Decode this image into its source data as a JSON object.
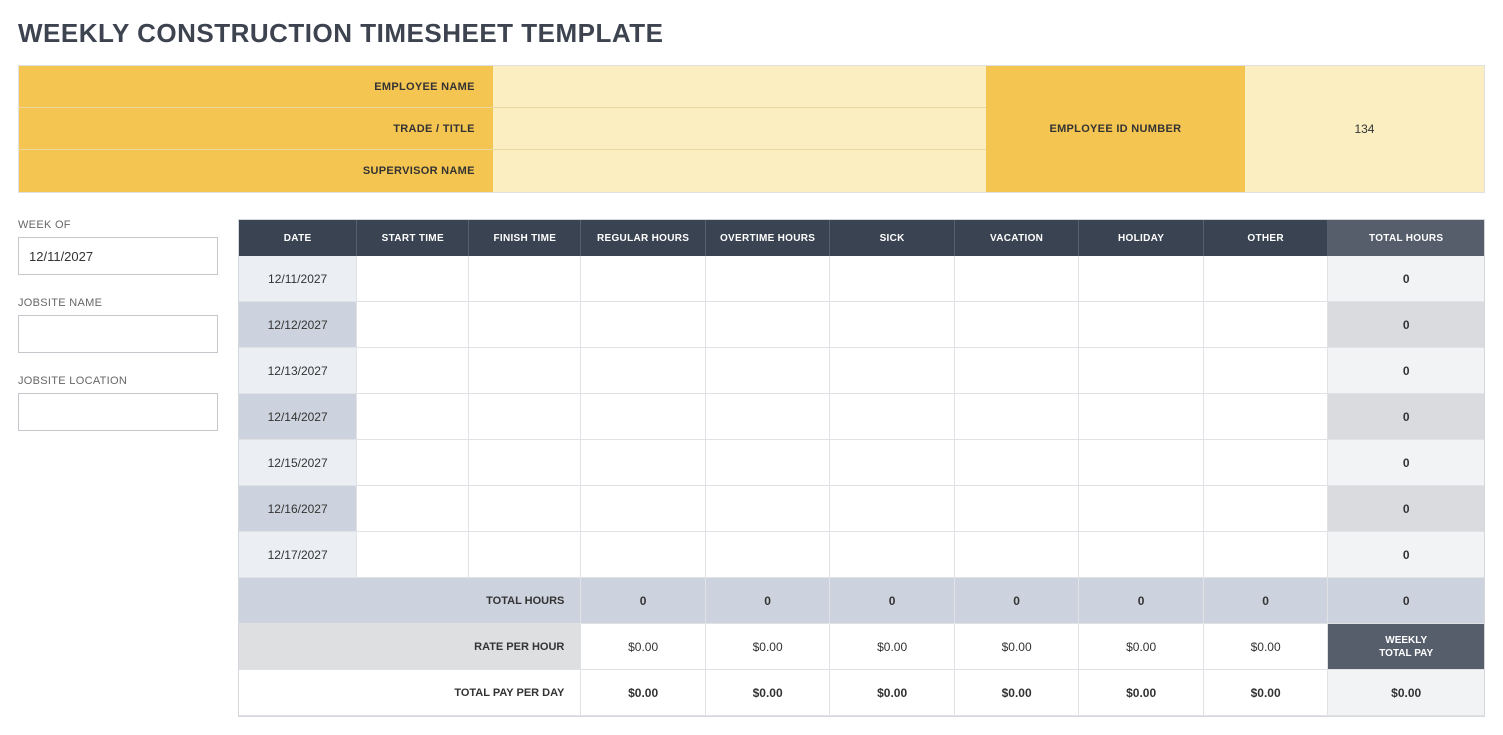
{
  "title": "WEEKLY CONSTRUCTION TIMESHEET TEMPLATE",
  "info": {
    "employee_name_label": "EMPLOYEE NAME",
    "employee_name_value": "",
    "trade_title_label": "TRADE / TITLE",
    "trade_title_value": "",
    "supervisor_name_label": "SUPERVISOR NAME",
    "supervisor_name_value": "",
    "employee_id_label": "EMPLOYEE ID NUMBER",
    "employee_id_value": "134"
  },
  "side": {
    "week_of_label": "WEEK OF",
    "week_of_value": "12/11/2027",
    "jobsite_name_label": "JOBSITE NAME",
    "jobsite_name_value": "",
    "jobsite_location_label": "JOBSITE LOCATION",
    "jobsite_location_value": ""
  },
  "columns": {
    "date": "DATE",
    "start": "START TIME",
    "finish": "FINISH TIME",
    "regular": "REGULAR HOURS",
    "overtime": "OVERTIME HOURS",
    "sick": "SICK",
    "vacation": "VACATION",
    "holiday": "HOLIDAY",
    "other": "OTHER",
    "total": "TOTAL HOURS"
  },
  "rows": [
    {
      "date": "12/11/2027",
      "start": "",
      "finish": "",
      "regular": "",
      "overtime": "",
      "sick": "",
      "vacation": "",
      "holiday": "",
      "other": "",
      "total": "0"
    },
    {
      "date": "12/12/2027",
      "start": "",
      "finish": "",
      "regular": "",
      "overtime": "",
      "sick": "",
      "vacation": "",
      "holiday": "",
      "other": "",
      "total": "0"
    },
    {
      "date": "12/13/2027",
      "start": "",
      "finish": "",
      "regular": "",
      "overtime": "",
      "sick": "",
      "vacation": "",
      "holiday": "",
      "other": "",
      "total": "0"
    },
    {
      "date": "12/14/2027",
      "start": "",
      "finish": "",
      "regular": "",
      "overtime": "",
      "sick": "",
      "vacation": "",
      "holiday": "",
      "other": "",
      "total": "0"
    },
    {
      "date": "12/15/2027",
      "start": "",
      "finish": "",
      "regular": "",
      "overtime": "",
      "sick": "",
      "vacation": "",
      "holiday": "",
      "other": "",
      "total": "0"
    },
    {
      "date": "12/16/2027",
      "start": "",
      "finish": "",
      "regular": "",
      "overtime": "",
      "sick": "",
      "vacation": "",
      "holiday": "",
      "other": "",
      "total": "0"
    },
    {
      "date": "12/17/2027",
      "start": "",
      "finish": "",
      "regular": "",
      "overtime": "",
      "sick": "",
      "vacation": "",
      "holiday": "",
      "other": "",
      "total": "0"
    }
  ],
  "footer": {
    "total_hours_label": "TOTAL HOURS",
    "total_hours": {
      "regular": "0",
      "overtime": "0",
      "sick": "0",
      "vacation": "0",
      "holiday": "0",
      "other": "0",
      "total": "0"
    },
    "rate_label": "RATE PER HOUR",
    "rate": {
      "regular": "$0.00",
      "overtime": "$0.00",
      "sick": "$0.00",
      "vacation": "$0.00",
      "holiday": "$0.00",
      "other": "$0.00"
    },
    "weekly_total_pay_label": "WEEKLY\nTOTAL PAY",
    "pay_label": "TOTAL PAY PER DAY",
    "pay": {
      "regular": "$0.00",
      "overtime": "$0.00",
      "sick": "$0.00",
      "vacation": "$0.00",
      "holiday": "$0.00",
      "other": "$0.00",
      "total": "$0.00"
    }
  }
}
